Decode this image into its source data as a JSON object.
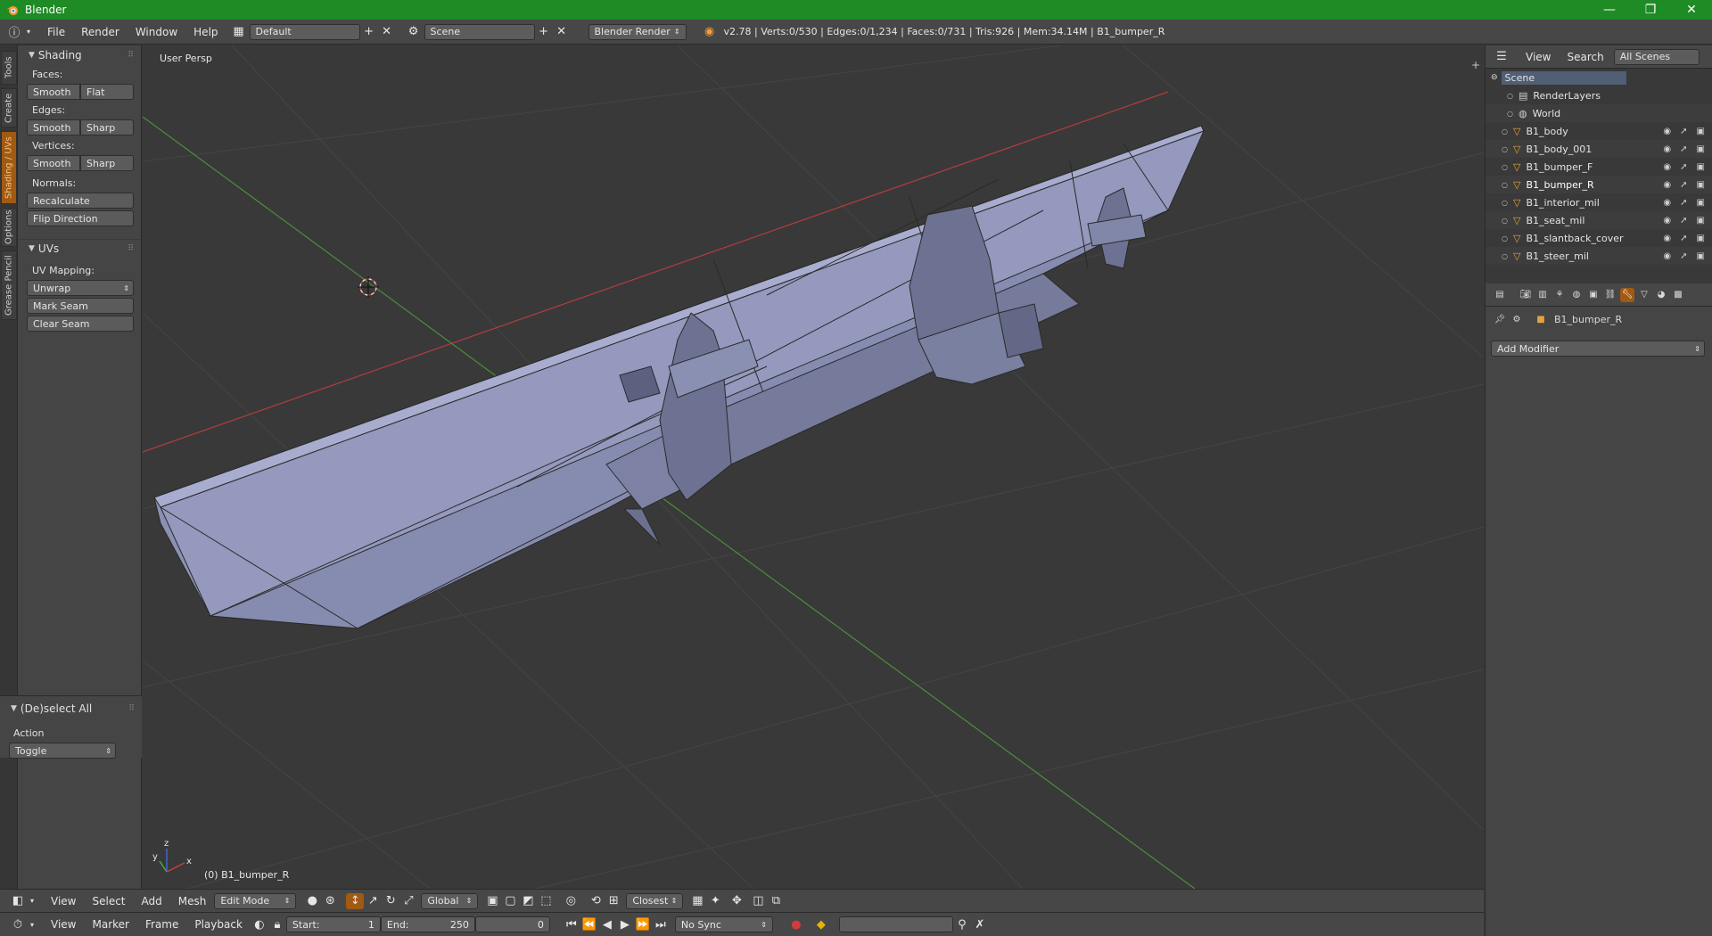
{
  "window": {
    "title": "Blender",
    "minimize": "—",
    "maximize": "❐",
    "close": "✕"
  },
  "info_header": {
    "menus": [
      "File",
      "Render",
      "Window",
      "Help"
    ],
    "screen_layout": "Default",
    "scene": "Scene",
    "render_engine": "Blender Render",
    "stats": "v2.78 | Verts:0/530 | Edges:0/1,234 | Faces:0/731 | Tris:926 | Mem:34.14M | B1_bumper_R"
  },
  "tool_tabs": [
    "Tools",
    "Create",
    "Shading / UVs",
    "Options",
    "Grease Pencil"
  ],
  "active_tool_tab": "Shading / UVs",
  "shading_panel": {
    "title": "Shading",
    "faces_label": "Faces:",
    "faces_buttons": [
      "Smooth",
      "Flat"
    ],
    "edges_label": "Edges:",
    "edges_buttons": [
      "Smooth",
      "Sharp"
    ],
    "vertices_label": "Vertices:",
    "vertices_buttons": [
      "Smooth",
      "Sharp"
    ],
    "normals_label": "Normals:",
    "recalculate": "Recalculate",
    "flip_direction": "Flip Direction"
  },
  "uvs_panel": {
    "title": "UVs",
    "uv_mapping_label": "UV Mapping:",
    "unwrap": "Unwrap",
    "mark_seam": "Mark Seam",
    "clear_seam": "Clear Seam"
  },
  "operator_panel": {
    "title": "(De)select All",
    "action_label": "Action",
    "action_value": "Toggle"
  },
  "viewport": {
    "view_name": "User Persp",
    "object_label": "(0) B1_bumper_R",
    "axis_x": "x",
    "axis_y": "y",
    "axis_z": "z"
  },
  "view3d_header": {
    "menus": [
      "View",
      "Select",
      "Add",
      "Mesh"
    ],
    "mode": "Edit Mode",
    "orientation": "Global",
    "snap_target": "Closest"
  },
  "timeline": {
    "menus": [
      "View",
      "Marker",
      "Frame",
      "Playback"
    ],
    "start_label": "Start:",
    "start_value": "1",
    "end_label": "End:",
    "end_value": "250",
    "current_frame": "0",
    "sync": "No Sync"
  },
  "outliner": {
    "view_menu": "View",
    "search_menu": "Search",
    "filter": "All Scenes",
    "scene_name": "Scene",
    "items": [
      {
        "name": "RenderLayers",
        "kind": "renderlayers"
      },
      {
        "name": "World",
        "kind": "world"
      },
      {
        "name": "B1_body",
        "kind": "mesh"
      },
      {
        "name": "B1_body_001",
        "kind": "mesh"
      },
      {
        "name": "B1_bumper_F",
        "kind": "mesh"
      },
      {
        "name": "B1_bumper_R",
        "kind": "mesh"
      },
      {
        "name": "B1_interior_mil",
        "kind": "mesh"
      },
      {
        "name": "B1_seat_mil",
        "kind": "mesh"
      },
      {
        "name": "B1_slantback_cover",
        "kind": "mesh"
      },
      {
        "name": "B1_steer_mil",
        "kind": "mesh"
      }
    ],
    "active_item": "B1_bumper_R"
  },
  "properties": {
    "context_object": "B1_bumper_R",
    "add_modifier": "Add Modifier"
  },
  "colors": {
    "titlebar": "#1e8b25",
    "accent": "#a05a12",
    "x_axis": "#b33d3d",
    "y_axis": "#4a8f3a",
    "mesh_face": "#8f95b8"
  }
}
